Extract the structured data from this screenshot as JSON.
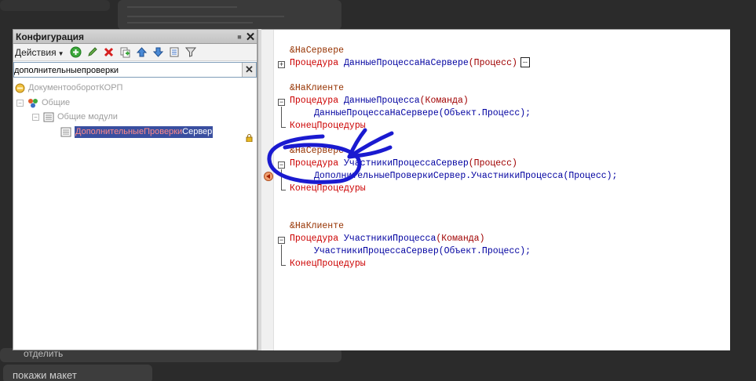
{
  "background": {
    "bottom_text": "покажи макет",
    "bottom_left_text": "отделить"
  },
  "config_panel": {
    "title": "Конфигурация",
    "actions_label": "Действия",
    "search": {
      "value": "дополнительныепроверки"
    },
    "tree": {
      "root": "ДокументооборотКОРП",
      "common": "Общие",
      "common_modules": "Общие модули",
      "selected_match": "ДополнительныеПроверки",
      "selected_rest": "Сервер"
    }
  },
  "editor": {
    "lines": {
      "l1_directive": "&НаСервере",
      "l2_keyword": "Процедура",
      "l2_name": "ДанныеПроцессаНаСервере",
      "l2_params": "(Процесс)",
      "l2_ellipsis": "…",
      "l3_directive": "&НаКлиенте",
      "l4_keyword": "Процедура",
      "l4_name": "ДанныеПроцесса",
      "l4_params": "(Команда)",
      "l5_call": "ДанныеПроцессаНаСервере(Объект.Процесс);",
      "l6_end": "КонецПроцедуры",
      "l7_directive": "&НаСервере",
      "l8_keyword": "Процедура",
      "l8_name": "УчастникиПроцессаСервер",
      "l8_params": "(Процесс)",
      "l9_call": "ДополнительныеПроверкиСервер.УчастникиПроцесса(Процесс);",
      "l10_end": "КонецПроцедуры",
      "l11_directive": "&НаКлиенте",
      "l12_keyword": "Процедура",
      "l12_name": "УчастникиПроцесса",
      "l12_params": "(Команда)",
      "l13_call": "УчастникиПроцессаСервер(Объект.Процесс);",
      "l14_end": "КонецПроцедуры"
    }
  },
  "colors": {
    "directive": "#963200",
    "keyword": "#cc0000",
    "identifier": "#0000a0",
    "annotation": "#1a1ad0",
    "selection": "#3a4fa0"
  },
  "icons": [
    "add-icon",
    "edit-icon",
    "delete-icon",
    "copy-icon",
    "move-up-icon",
    "move-down-icon",
    "list-icon",
    "filter-icon",
    "close-icon",
    "pin-icon",
    "clear-icon",
    "config-root-icon",
    "common-icon",
    "modules-icon",
    "module-icon",
    "lock-icon",
    "breakpoint-icon"
  ]
}
